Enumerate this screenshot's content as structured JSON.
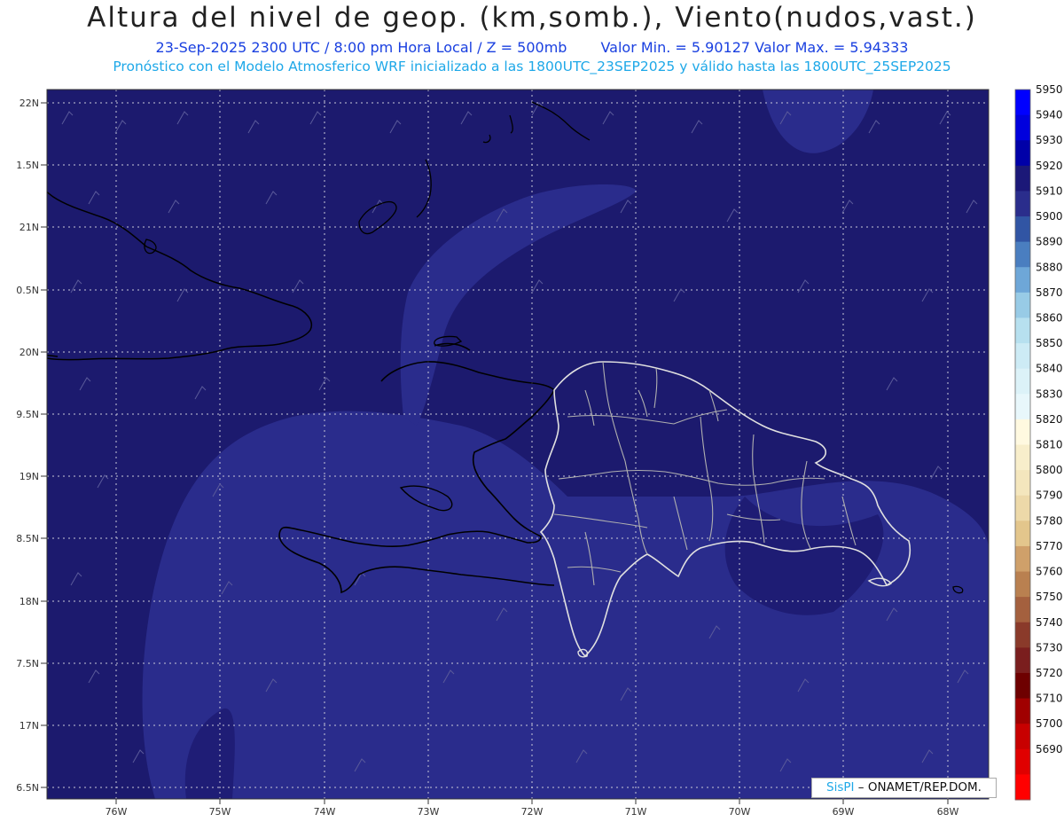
{
  "title": "Altura del nivel de geop. (km,somb.), Viento(nudos,vast.)",
  "subtitle": {
    "datetime": "23-Sep-2025  2300 UTC / 8:00 pm Hora Local / Z = 500mb",
    "range": "Valor Min. = 5.90127  Valor Max. = 5.94333"
  },
  "model_info": "Pronóstico con el Modelo Atmosferico WRF inicializado a las 1800UTC_23SEP2025 y válido hasta las  1800UTC_25SEP2025",
  "lat_labels": [
    "22N",
    "1.5N",
    "21N",
    "0.5N",
    "20N",
    "9.5N",
    "19N",
    "8.5N",
    "18N",
    "7.5N",
    "17N",
    "6.5N"
  ],
  "lon_labels": [
    "76W",
    "75W",
    "74W",
    "73W",
    "72W",
    "71W",
    "70W",
    "69W",
    "68W"
  ],
  "legend": {
    "levels": [
      "5950",
      "5940",
      "5930",
      "5920",
      "5910",
      "5900",
      "5890",
      "5880",
      "5870",
      "5860",
      "5850",
      "5840",
      "5830",
      "5820",
      "5810",
      "5800",
      "5790",
      "5780",
      "5770",
      "5760",
      "5750",
      "5740",
      "5730",
      "5720",
      "5710",
      "5700",
      "5690"
    ],
    "colors": [
      "#0000ff",
      "#0000dd",
      "#0000a8",
      "#1b1878",
      "#2a2d8c",
      "#3155a4",
      "#4a7ec0",
      "#6ea7d8",
      "#98cbe6",
      "#b7e0ef",
      "#cdebf5",
      "#dcf2f8",
      "#e8f7fb",
      "#fff9e0",
      "#f8eecb",
      "#f4e6bd",
      "#edd9a9",
      "#e3c68c",
      "#cfa06a",
      "#b98050",
      "#a4603e",
      "#8a3a2a",
      "#7a1e1e",
      "#6e0000",
      "#a00000",
      "#c80000",
      "#e00000",
      "#ff0000"
    ]
  },
  "credit": {
    "brand": "SisPI",
    "text": "– ONAMET/REP.DOM."
  },
  "colors": {
    "field_base": "#1c1a6e",
    "field_light": "#2a2c8c",
    "title_blue": "#1a40e0",
    "info_cyan": "#1ea8e8"
  }
}
